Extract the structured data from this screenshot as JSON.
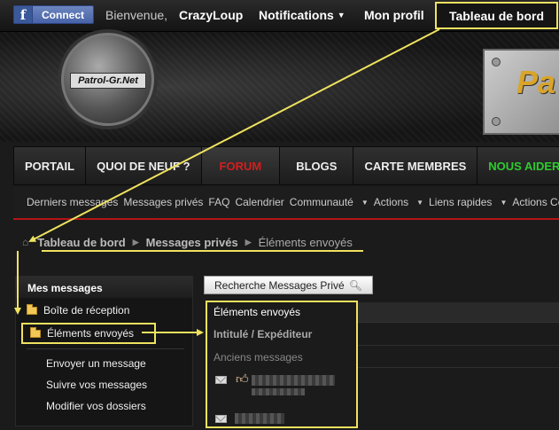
{
  "topbar": {
    "facebook_label": "Connect",
    "welcome": "Bienvenue,",
    "username": "CrazyLoup",
    "notifications": "Notifications",
    "profile": "Mon profil",
    "dashboard": "Tableau de bord"
  },
  "banner": {
    "logo_text": "Patrol-Gr.Net",
    "plate_text": "Pa"
  },
  "nav": {
    "items": [
      "PORTAIL",
      "QUOI DE NEUF ?",
      "FORUM",
      "BLOGS",
      "CARTE MEMBRES",
      "NOUS AIDER"
    ],
    "active": "FORUM"
  },
  "subnav": {
    "items": [
      "Derniers messages",
      "Messages privés",
      "FAQ",
      "Calendrier",
      "Communauté",
      "Actions",
      "Liens rapides",
      "Actions Con"
    ]
  },
  "breadcrumb": {
    "items": [
      "Tableau de bord",
      "Messages privés",
      "Éléments envoyés"
    ]
  },
  "sidebar": {
    "title": "Mes messages",
    "folders": [
      "Boîte de réception",
      "Éléments envoyés"
    ],
    "links": [
      "Envoyer un message",
      "Suivre vos messages",
      "Modifier vos dossiers"
    ]
  },
  "search": {
    "label": "Recherche Messages Privé"
  },
  "main": {
    "title": "Éléments envoyés",
    "column_header": "Intitulé / Expéditeur",
    "section": "Anciens messages"
  },
  "colors": {
    "highlight": "#efe25f",
    "active_nav": "#d31e1e",
    "green_nav": "#2ecc2e"
  }
}
